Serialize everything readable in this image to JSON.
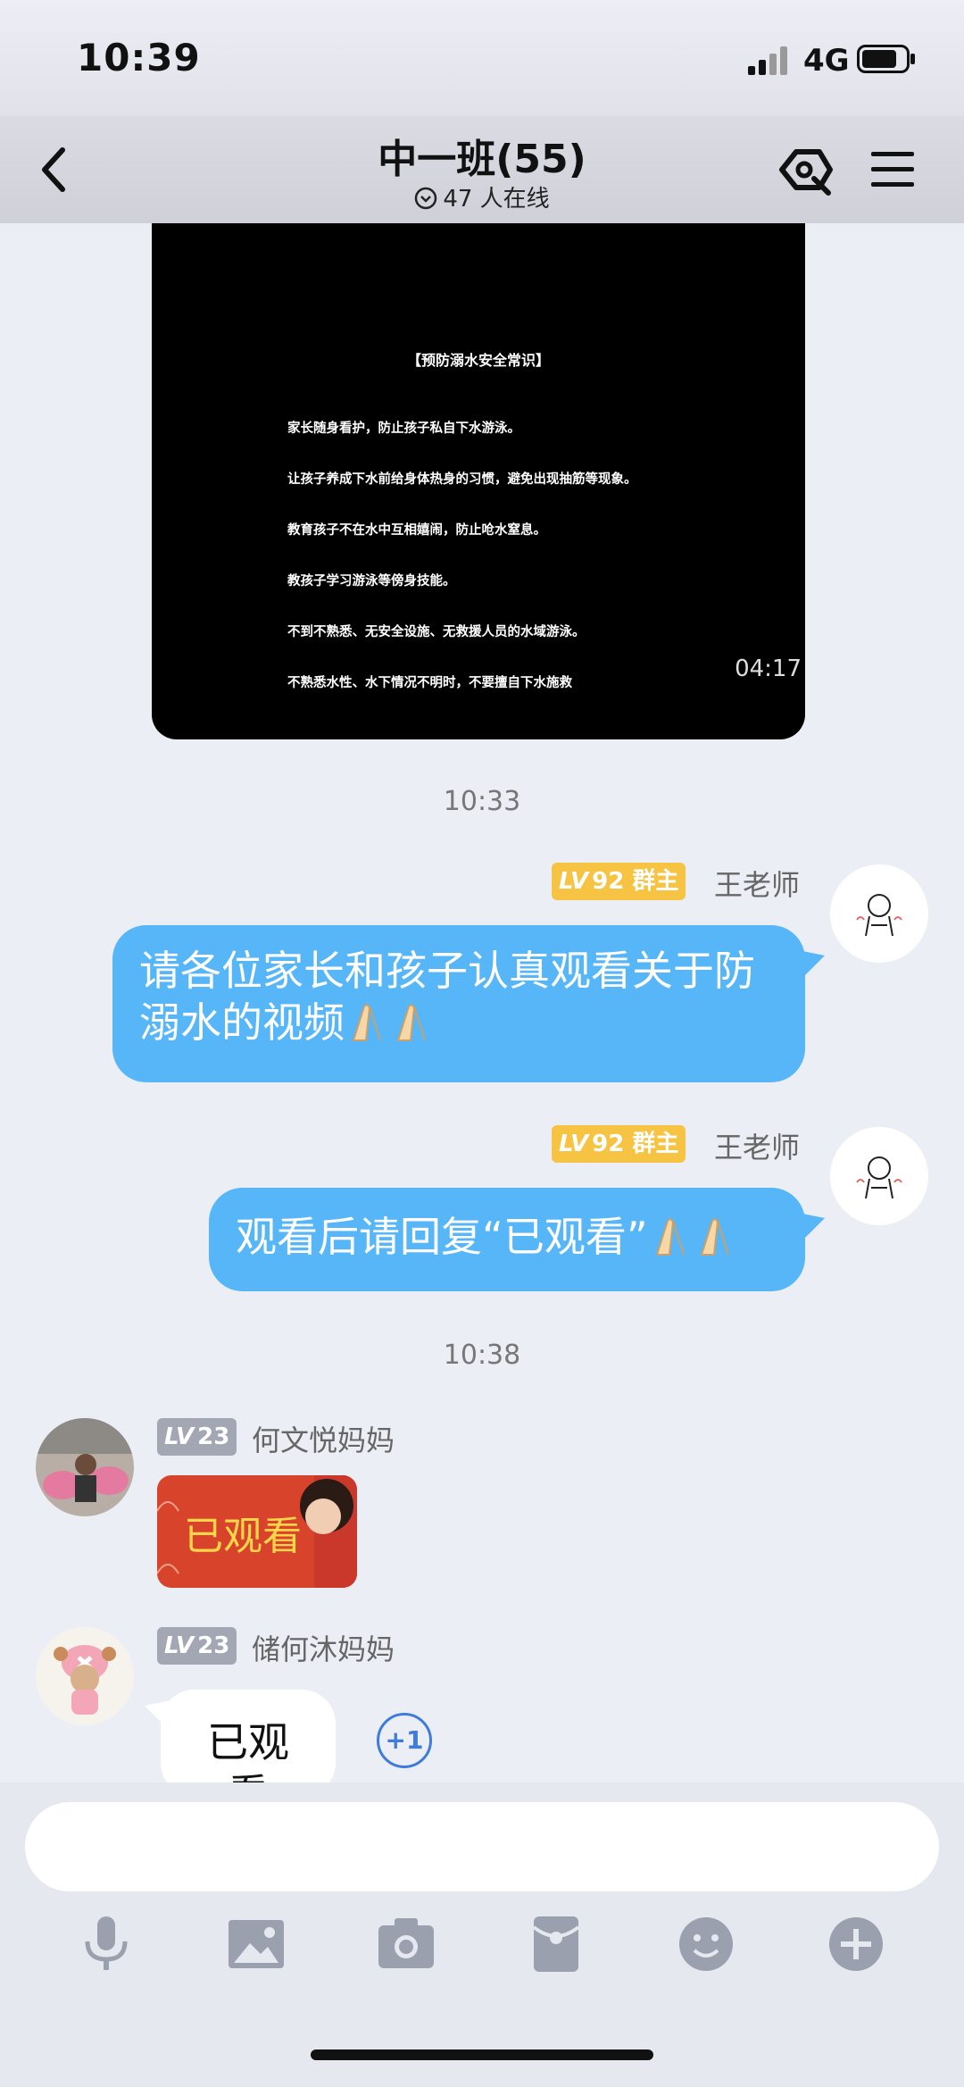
{
  "status_bar": {
    "time": "10:39",
    "network": "4G"
  },
  "header": {
    "title": "中一班(55)",
    "online": "47 人在线"
  },
  "video": {
    "heading": "【预防溺水安全常识】",
    "lines": [
      "家长随身看护，防止孩子私自下水游泳。",
      "让孩子养成下水前给身体热身的习惯，避免出现抽筋等现象。",
      "教育孩子不在水中互相嬉闹，防止呛水窒息。",
      "教孩子学习游泳等傍身技能。",
      "不到不熟悉、无安全设施、无救援人员的水域游泳。",
      "不熟悉水性、水下情况不明时，不要擅自下水施救"
    ],
    "duration": "04:17"
  },
  "timestamps": {
    "first": "10:33",
    "second": "10:38"
  },
  "messages": [
    {
      "sender": "王老师",
      "level": "92",
      "role": "群主",
      "text": "请各位家长和孩子认真观看关于防溺水的视频"
    },
    {
      "sender": "王老师",
      "level": "92",
      "role": "群主",
      "text": "观看后请回复“已观看”"
    },
    {
      "sender": "何文悦妈妈",
      "level": "23",
      "sticker_text": "已观看"
    },
    {
      "sender": "储何沐妈妈",
      "level": "23",
      "text": "已观看",
      "plus_one": "+1"
    }
  ],
  "badge_prefix": "LV",
  "toolbar": [
    "mic-icon",
    "image-icon",
    "camera-icon",
    "red-packet-icon",
    "emoji-icon",
    "plus-icon"
  ],
  "colors": {
    "bubble_blue": "#56b6f7",
    "badge_gold": "#f6c342",
    "badge_gray": "#a3a7b3",
    "plus_blue": "#3e7bdb"
  }
}
